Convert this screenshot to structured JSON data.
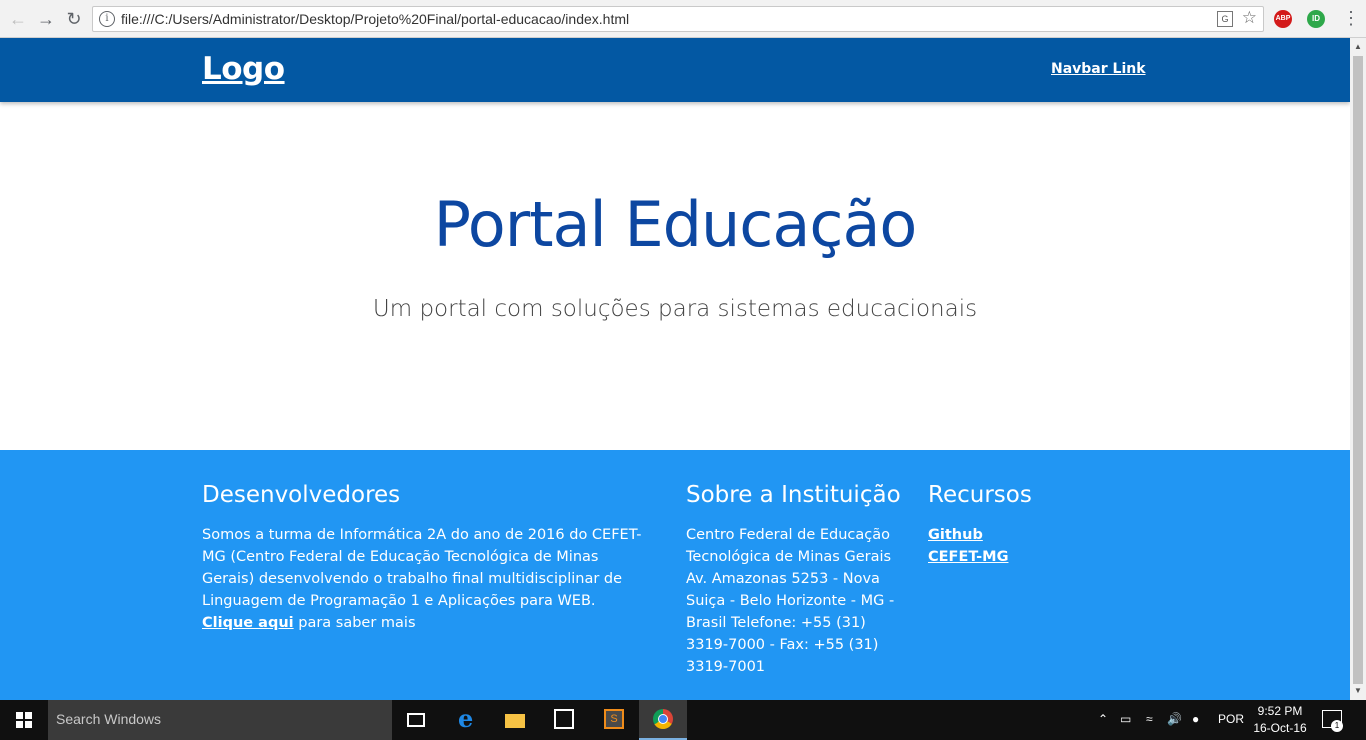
{
  "browser": {
    "url": "file:///C:/Users/Administrator/Desktop/Projeto%20Final/portal-educacao/index.html",
    "ext_abp": "ABP",
    "ext_id": "ID"
  },
  "navbar": {
    "logo": "Logo",
    "link": "Navbar Link",
    "color": "#0358a3"
  },
  "hero": {
    "title": "Portal Educação",
    "subtitle": "Um portal com soluções para sistemas educacionais",
    "title_color": "#0d47a1"
  },
  "footer": {
    "color": "#2196f3",
    "developers": {
      "title": "Desenvolvedores",
      "text": "Somos a turma de Informática 2A do ano de 2016 do CEFET-MG (Centro Federal de Educação Tecnológica de Minas Gerais) desenvolvendo o trabalho final multidisciplinar de Linguagem de Programação 1 e Aplicações para WEB.",
      "link": "Clique aqui",
      "link_suffix": " para saber mais"
    },
    "institution": {
      "title": "Sobre a Instituição",
      "text": "Centro Federal de Educação Tecnológica de Minas Gerais Av. Amazonas 5253 - Nova Suiça - Belo Horizonte - MG - Brasil Telefone: +55 (31) 3319-7000 - Fax: +55 (31) 3319-7001"
    },
    "resources": {
      "title": "Recursos",
      "links": [
        "Github",
        "CEFET-MG"
      ]
    }
  },
  "taskbar": {
    "search_placeholder": "Search Windows",
    "language": "POR",
    "time": "9:52 PM",
    "date": "16-Oct-16",
    "notification_count": "1",
    "sublime_letter": "S"
  }
}
